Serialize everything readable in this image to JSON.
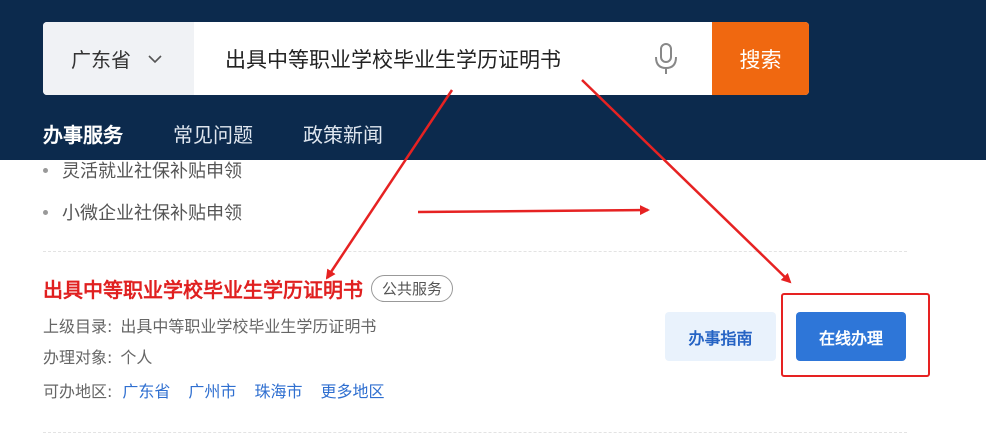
{
  "search": {
    "region": "广东省",
    "query": "出具中等职业学校毕业生学历证明书",
    "button_label": "搜索"
  },
  "tabs": [
    {
      "label": "办事服务",
      "active": true
    },
    {
      "label": "常见问题",
      "active": false
    },
    {
      "label": "政策新闻",
      "active": false
    }
  ],
  "bullets": [
    "灵活就业社保补贴申领",
    "小微企业社保补贴申领"
  ],
  "result": {
    "title": "出具中等职业学校毕业生学历证明书",
    "tag": "公共服务",
    "parent_label": "上级目录:",
    "parent_value": "出具中等职业学校毕业生学历证明书",
    "target_label": "办理对象:",
    "target_value": "个人",
    "region_label": "可办地区:",
    "regions": [
      "广东省",
      "广州市",
      "珠海市",
      "更多地区"
    ],
    "guide_label": "办事指南",
    "online_label": "在线办理"
  },
  "colors": {
    "header_bg": "#0c2a4d",
    "search_button": "#f06810",
    "title_red": "#e02020",
    "primary_blue": "#2e76d8",
    "annotation_red": "#e62222"
  },
  "icons": [
    "chevron-down-icon",
    "microphone-icon",
    "arrow-annotation"
  ]
}
